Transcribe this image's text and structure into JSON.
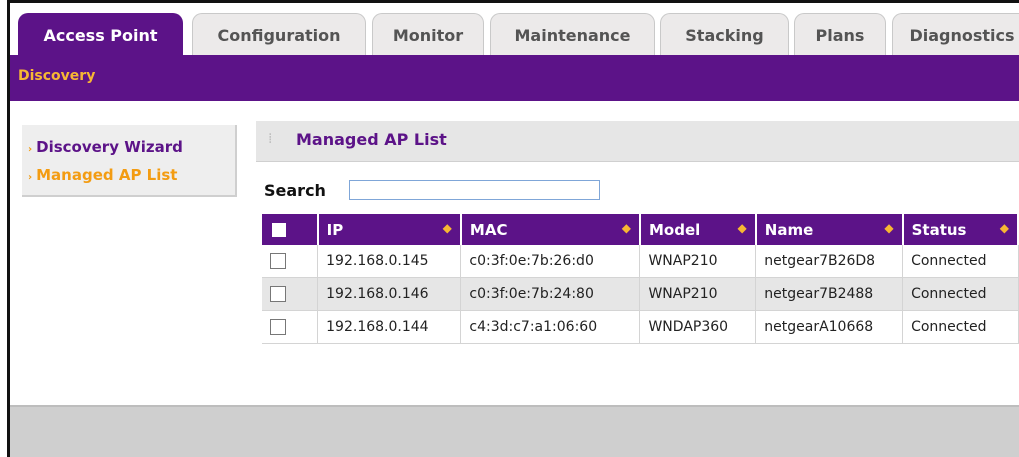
{
  "tabs": [
    "Access Point",
    "Configuration",
    "Monitor",
    "Maintenance",
    "Stacking",
    "Plans",
    "Diagnostics"
  ],
  "subtab": "Discovery",
  "sidebar": {
    "items": [
      "Discovery Wizard",
      "Managed AP List"
    ]
  },
  "panel": {
    "title": "Managed AP List"
  },
  "search": {
    "label": "Search",
    "value": ""
  },
  "table": {
    "headers": [
      "IP",
      "MAC",
      "Model",
      "Name",
      "Status"
    ],
    "rows": [
      [
        "192.168.0.145",
        "c0:3f:0e:7b:26:d0",
        "WNAP210",
        "netgear7B26D8",
        "Connected"
      ],
      [
        "192.168.0.146",
        "c0:3f:0e:7b:24:80",
        "WNAP210",
        "netgear7B2488",
        "Connected"
      ],
      [
        "192.168.0.144",
        "c4:3d:c7:a1:06:60",
        "WNDAP360",
        "netgearA10668",
        "Connected"
      ]
    ]
  },
  "colors": {
    "brand_purple": "#5c1388",
    "accent_orange": "#f39c12"
  }
}
